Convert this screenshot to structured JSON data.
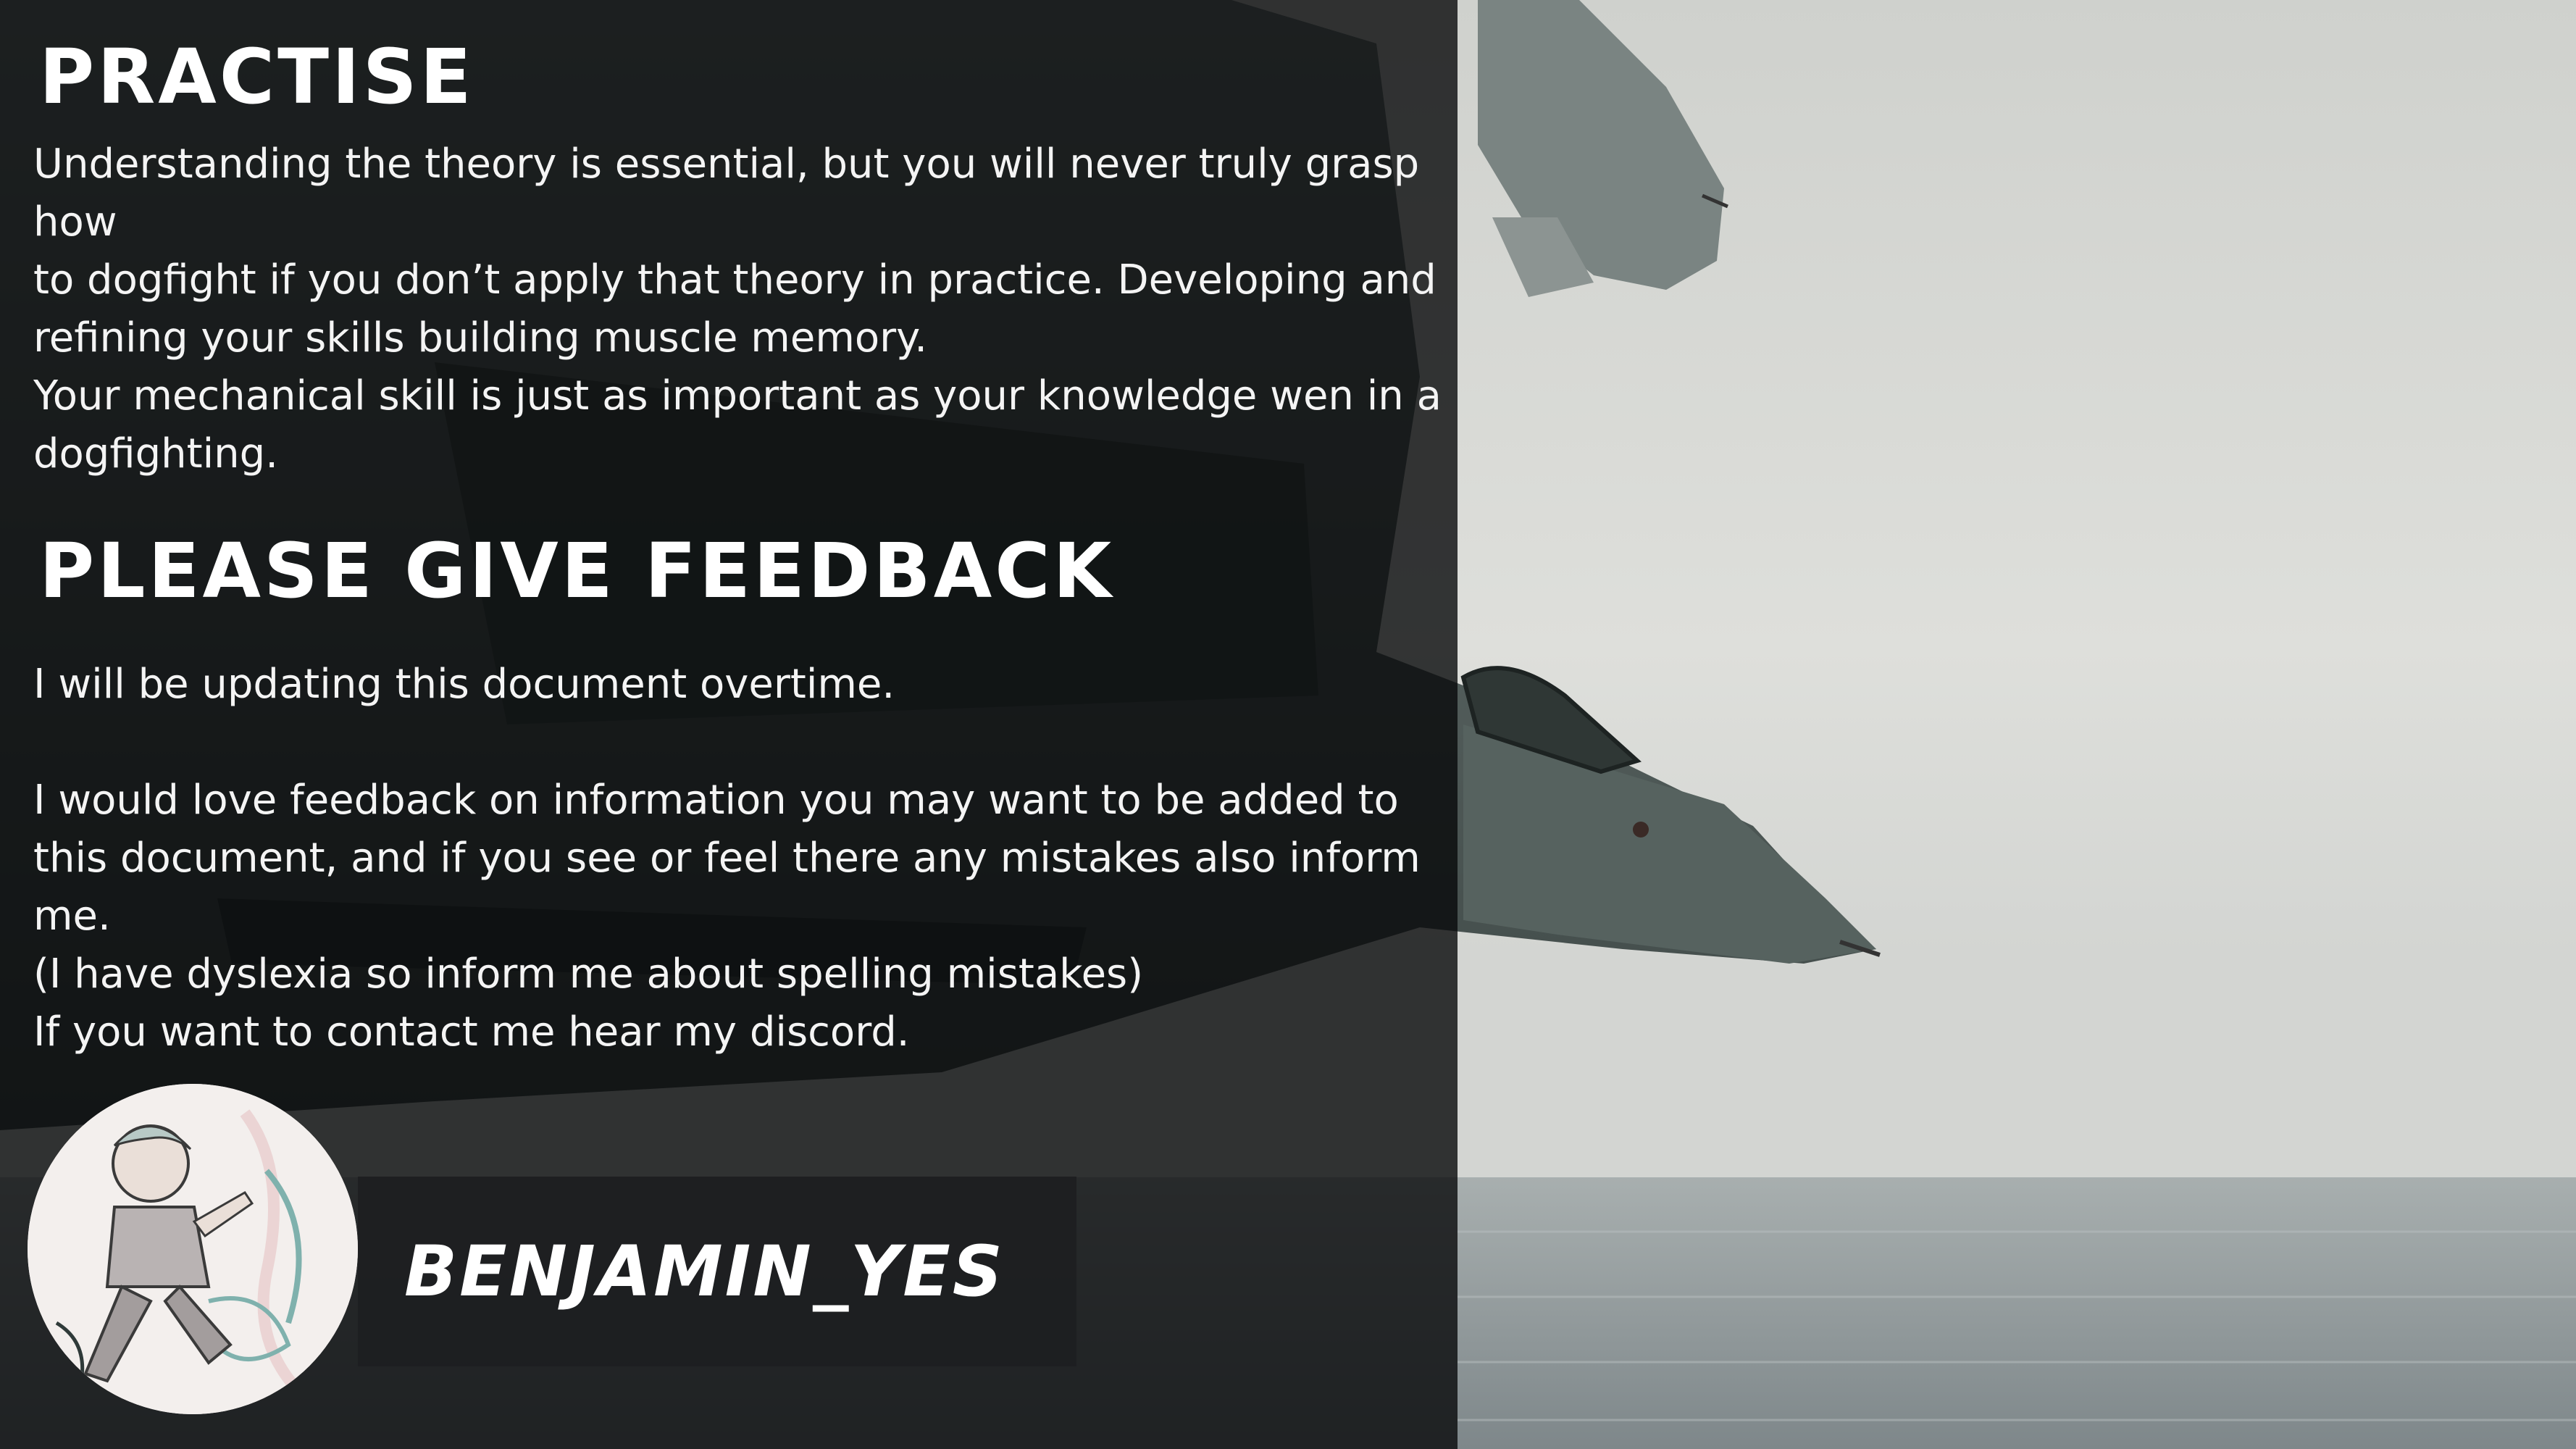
{
  "sections": {
    "practise": {
      "title": "PRACTISE",
      "paragraphs": [
        "Understanding the theory is essential, but you will never truly grasp how\nto dogfight if you don’t apply that theory in practice. Developing and\nrefining your skills building muscle memory.",
        "Your mechanical skill is just as important as your knowledge wen in a\ndogfighting."
      ]
    },
    "feedback": {
      "title": "PLEASE GIVE FEEDBACK",
      "paragraphs": [
        "I will be updating this document overtime.",
        "I would love feedback on information you may want to be added to\nthis document, and if you see or feel there any mistakes also inform me.\n(I have dyslexia so inform me about spelling mistakes)",
        "If you want to contact me hear my discord."
      ]
    }
  },
  "contact": {
    "discord_name": "BENJAMIN_YES"
  },
  "colors": {
    "overlay": "#08090a",
    "text": "#ffffff",
    "name_bar": "#1e1f21",
    "sky": "#d6d7d4",
    "sea": "#8f989a"
  }
}
